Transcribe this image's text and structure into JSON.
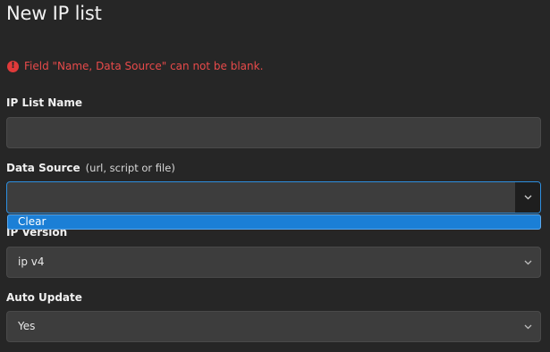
{
  "form": {
    "title": "New IP list",
    "error_message": "Field \"Name, Data Source\" can not be blank.",
    "error_icon": "exclamation-circle-icon",
    "fields": {
      "name": {
        "label": "IP List Name",
        "value": ""
      },
      "data_source": {
        "label": "Data Source",
        "hint": "(url, script or file)",
        "value": ""
      },
      "ip_version": {
        "label": "IP Version",
        "value": "ip v4"
      },
      "auto_update": {
        "label": "Auto Update",
        "value": "Yes"
      }
    },
    "dropdown": {
      "options": [
        "Clear"
      ]
    }
  },
  "colors": {
    "background": "#262626",
    "field": "#3d3d3d",
    "error": "#e84a4a",
    "accent": "#1b7fd6",
    "focus_border": "#2d8fe0"
  }
}
